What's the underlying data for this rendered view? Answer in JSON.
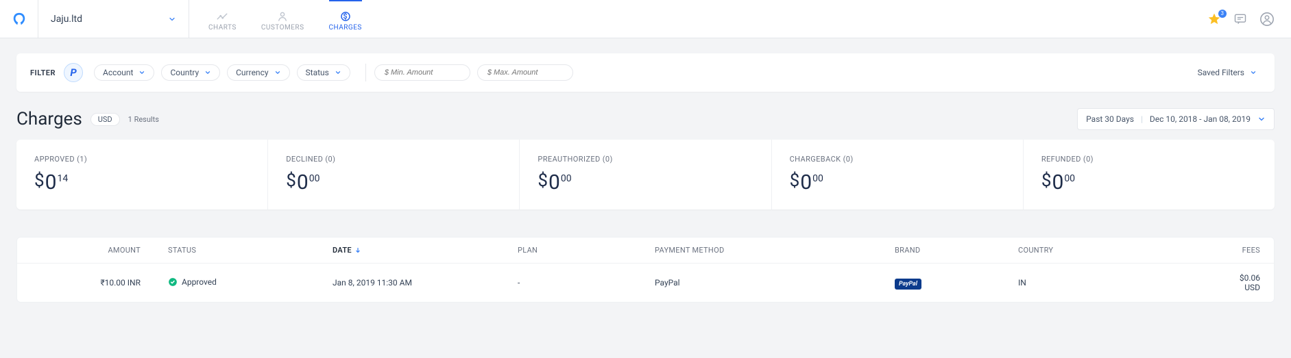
{
  "org": {
    "name": "Jaju.ltd"
  },
  "nav": {
    "charts": "CHARTS",
    "customers": "CUSTOMERS",
    "charges": "CHARGES",
    "active": "charges",
    "star_badge": "3"
  },
  "filter": {
    "label": "FILTER",
    "account": "Account",
    "country": "Country",
    "currency": "Currency",
    "status": "Status",
    "min_placeholder": "$ Min. Amount",
    "max_placeholder": "$ Max. Amount",
    "saved": "Saved Filters"
  },
  "page": {
    "title": "Charges",
    "currency": "USD",
    "results": "1 Results"
  },
  "date_range": {
    "label": "Past 30 Days",
    "range": "Dec 10, 2018 - Jan 08, 2019"
  },
  "stats": {
    "approved": {
      "label": "APPROVED  (1)",
      "major": "0",
      "minor": "14"
    },
    "declined": {
      "label": "DECLINED  (0)",
      "major": "0",
      "minor": "00"
    },
    "preauthorized": {
      "label": "PREAUTHORIZED  (0)",
      "major": "0",
      "minor": "00"
    },
    "chargeback": {
      "label": "CHARGEBACK  (0)",
      "major": "0",
      "minor": "00"
    },
    "refunded": {
      "label": "REFUNDED  (0)",
      "major": "0",
      "minor": "00"
    }
  },
  "table": {
    "headers": {
      "amount": "AMOUNT",
      "status": "STATUS",
      "date": "DATE",
      "plan": "PLAN",
      "payment_method": "PAYMENT METHOD",
      "brand": "BRAND",
      "country": "COUNTRY",
      "fees": "FEES"
    },
    "row": {
      "amount": "₹10.00 INR",
      "status": "Approved",
      "date": "Jan 8, 2019 11:30 AM",
      "plan": "-",
      "payment_method": "PayPal",
      "brand": "PayPal",
      "country": "IN",
      "fees": "$0.06 USD"
    }
  }
}
